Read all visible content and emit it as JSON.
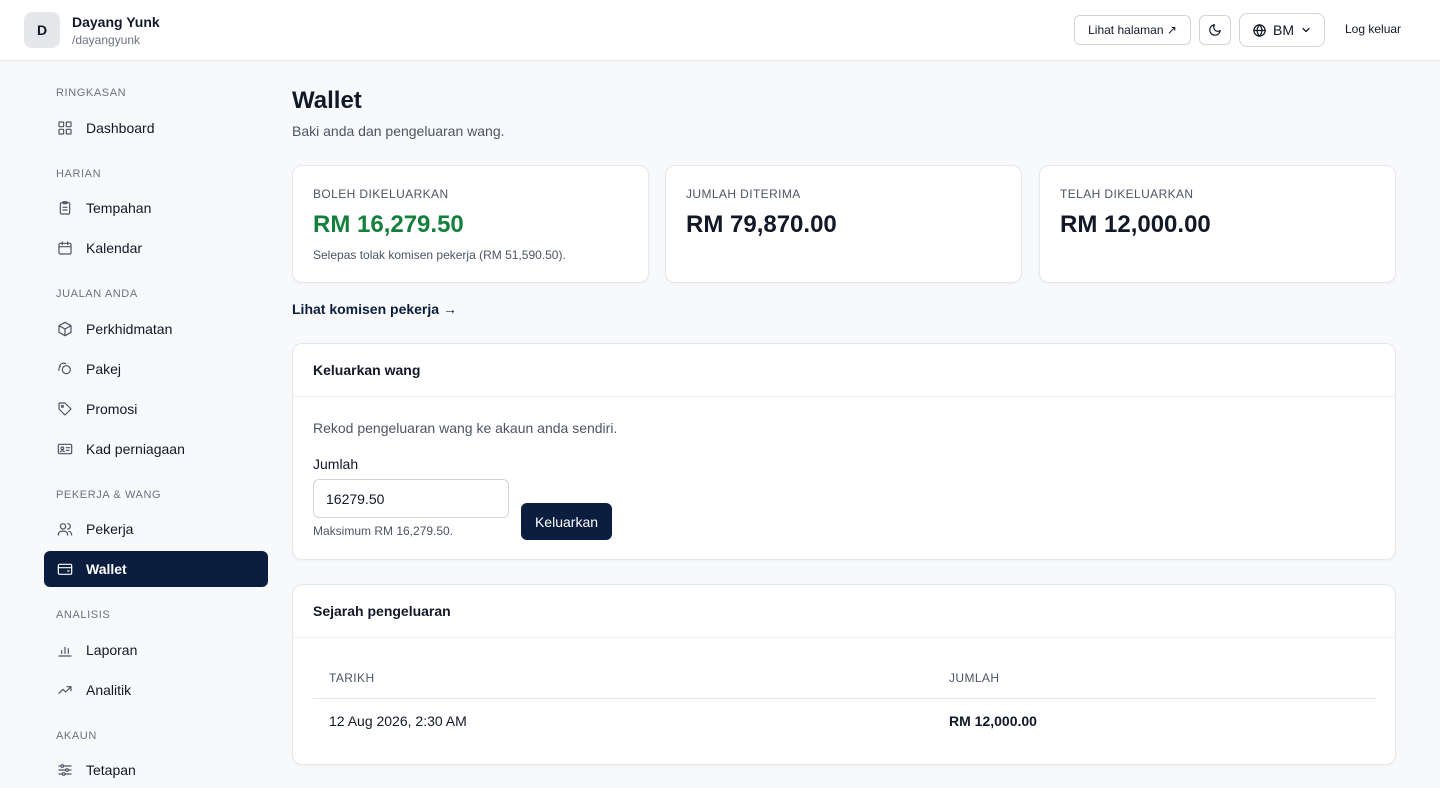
{
  "header": {
    "avatar_initial": "D",
    "business_name": "Dayang Yunk",
    "business_handle": "/dayangyunk",
    "view_page_label": "Lihat halaman ↗",
    "language_label": "BM",
    "logout_label": "Log keluar"
  },
  "sidebar": {
    "sections": {
      "summary": "RINGKASAN",
      "daily": "HARIAN",
      "sales": "JUALAN ANDA",
      "staff_money": "PEKERJA & WANG",
      "analysis": "ANALISIS",
      "account": "AKAUN"
    },
    "items": {
      "dashboard": "Dashboard",
      "bookings": "Tempahan",
      "calendar": "Kalendar",
      "services": "Perkhidmatan",
      "packages": "Pakej",
      "promotions": "Promosi",
      "business_card": "Kad perniagaan",
      "staff": "Pekerja",
      "wallet": "Wallet",
      "reports": "Laporan",
      "analytics": "Analitik",
      "settings": "Tetapan"
    }
  },
  "main": {
    "title": "Wallet",
    "subtitle": "Baki anda dan pengeluaran wang.",
    "stats": {
      "withdrawable_label": "BOLEH DIKELUARKAN",
      "withdrawable_value": "RM 16,279.50",
      "withdrawable_note": "Selepas tolak komisen pekerja (RM 51,590.50).",
      "received_label": "JUMLAH DITERIMA",
      "received_value": "RM 79,870.00",
      "withdrawn_label": "TELAH DIKELUARKAN",
      "withdrawn_value": "RM 12,000.00"
    },
    "commission_link": "Lihat komisen pekerja →",
    "withdraw": {
      "title": "Keluarkan wang",
      "description": "Rekod pengeluaran wang ke akaun anda sendiri.",
      "amount_label": "Jumlah",
      "amount_value": "16279.50",
      "max_hint": "Maksimum RM 16,279.50.",
      "submit_label": "Keluarkan"
    },
    "history": {
      "title": "Sejarah pengeluaran",
      "columns": {
        "date": "TARIKH",
        "amount": "JUMLAH"
      },
      "rows": [
        {
          "date": "12 Aug 2026, 2:30 AM",
          "amount": "RM 12,000.00"
        }
      ]
    }
  },
  "colors": {
    "primary": "#0b1e3f",
    "positive": "#15803d",
    "border": "#e5e7eb",
    "background": "#f8f9fb"
  }
}
